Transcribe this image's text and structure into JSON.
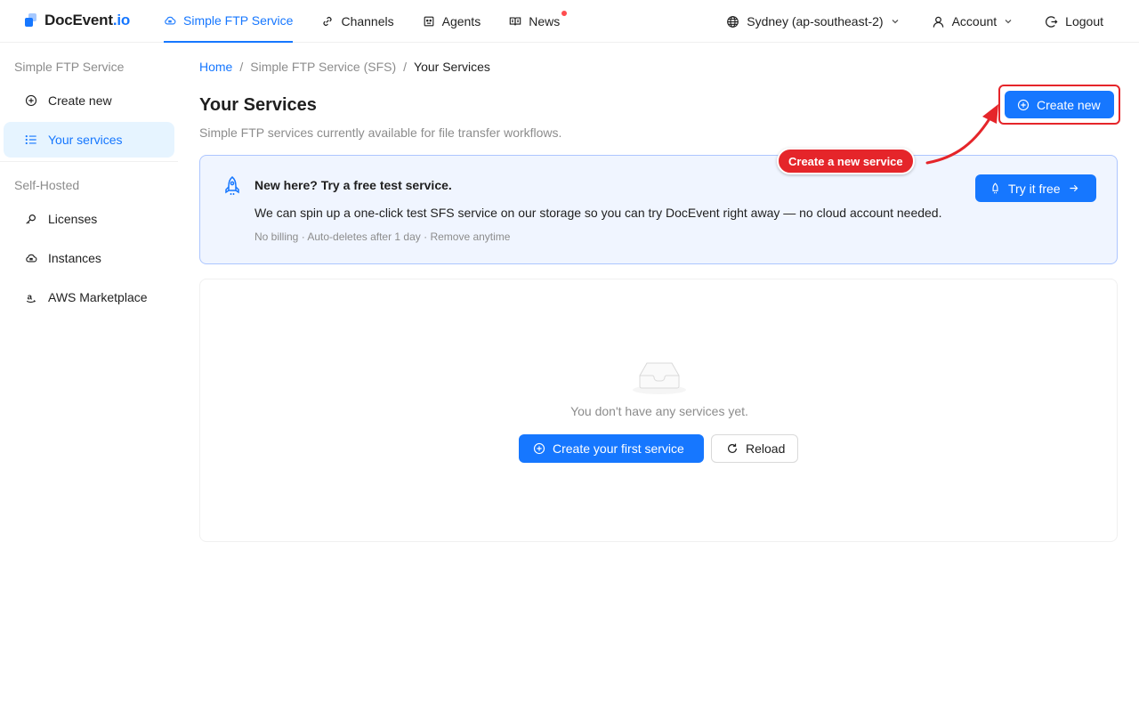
{
  "brand": {
    "name": "DocEvent",
    "suffix": ".io"
  },
  "nav": {
    "items": [
      {
        "label": "Simple FTP Service",
        "icon": "cloud-icon",
        "active": true
      },
      {
        "label": "Channels",
        "icon": "link-icon"
      },
      {
        "label": "Agents",
        "icon": "robot-icon"
      },
      {
        "label": "News",
        "icon": "book-icon",
        "badge": true
      }
    ],
    "region": "Sydney (ap-southeast-2)",
    "account": "Account",
    "logout": "Logout"
  },
  "sidebar": {
    "group1": "Simple FTP Service",
    "create_new": "Create new",
    "your_services": "Your services",
    "group2": "Self-Hosted",
    "licenses": "Licenses",
    "instances": "Instances",
    "aws": "AWS Marketplace"
  },
  "breadcrumb": {
    "home": "Home",
    "sfs": "Simple FTP Service (SFS)",
    "current": "Your Services"
  },
  "page": {
    "title": "Your Services",
    "subtitle": "Simple FTP services currently available for file transfer workflows.",
    "create_new": "Create new"
  },
  "annotation": {
    "label": "Create a new service"
  },
  "trial": {
    "title": "New here? Try a free test service.",
    "description": "We can spin up a one-click test SFS service on our storage so you can try DocEvent right away — no cloud account needed.",
    "note": "No billing · Auto-deletes after 1 day · Remove anytime",
    "button": "Try it free"
  },
  "empty": {
    "message": "You don't have any services yet.",
    "create_first": "Create your first service",
    "reload": "Reload"
  },
  "colors": {
    "primary": "#1677ff",
    "annotation": "#e5252a",
    "trial_bg": "#f0f5ff"
  }
}
